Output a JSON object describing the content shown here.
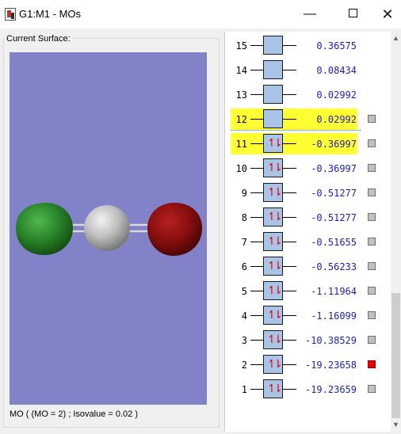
{
  "window": {
    "title": "G1:M1 - MOs",
    "minimize_glyph": "—",
    "close_glyph": "✕"
  },
  "surface": {
    "group_label": "Current Surface:",
    "caption": "MO ( (MO = 2) ; Isovalue = 0.02 )",
    "background_color": "#8282c9",
    "atom_colors": {
      "left": "#2c8a2c",
      "center": "#c6c6c6",
      "right": "#8b0f0f"
    }
  },
  "orbitals": [
    {
      "num": "15",
      "energy": "0.36575",
      "occupied": false,
      "highlight": false,
      "check": "none"
    },
    {
      "num": "14",
      "energy": "0.08434",
      "occupied": false,
      "highlight": false,
      "check": "none"
    },
    {
      "num": "13",
      "energy": "0.02992",
      "occupied": false,
      "highlight": false,
      "check": "none"
    },
    {
      "num": "12",
      "energy": "0.02992",
      "occupied": false,
      "highlight": true,
      "check": "gray"
    },
    {
      "num": "11",
      "energy": "-0.36997",
      "occupied": true,
      "highlight": true,
      "check": "gray"
    },
    {
      "num": "10",
      "energy": "-0.36997",
      "occupied": true,
      "highlight": false,
      "check": "gray"
    },
    {
      "num": "9",
      "energy": "-0.51277",
      "occupied": true,
      "highlight": false,
      "check": "gray"
    },
    {
      "num": "8",
      "energy": "-0.51277",
      "occupied": true,
      "highlight": false,
      "check": "gray"
    },
    {
      "num": "7",
      "energy": "-0.51655",
      "occupied": true,
      "highlight": false,
      "check": "gray"
    },
    {
      "num": "6",
      "energy": "-0.56233",
      "occupied": true,
      "highlight": false,
      "check": "gray"
    },
    {
      "num": "5",
      "energy": "-1.11964",
      "occupied": true,
      "highlight": false,
      "check": "gray"
    },
    {
      "num": "4",
      "energy": "-1.16099",
      "occupied": true,
      "highlight": false,
      "check": "gray"
    },
    {
      "num": "3",
      "energy": "-10.38529",
      "occupied": true,
      "highlight": false,
      "check": "gray"
    },
    {
      "num": "2",
      "energy": "-19.23658",
      "occupied": true,
      "highlight": false,
      "check": "red"
    },
    {
      "num": "1",
      "energy": "-19.23659",
      "occupied": true,
      "highlight": false,
      "check": "gray"
    }
  ],
  "colors": {
    "highlight": "#ffff33",
    "energy_text": "#1f1fb8",
    "level_box": "#a9c4e6",
    "electron_arrow": "#e00000"
  }
}
